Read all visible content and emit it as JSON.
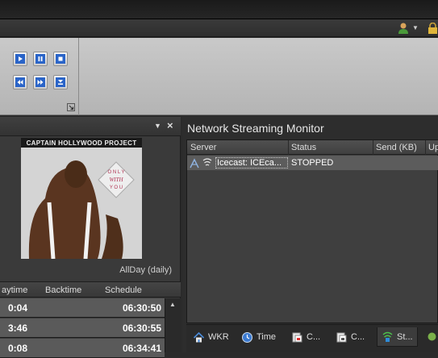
{
  "ribbon": {
    "buttons": [
      "play-icon",
      "pause-icon",
      "stop-icon",
      "rewind-icon",
      "fast-forward-icon",
      "skip-down-icon"
    ],
    "launcher_icon": "dialog-launcher-icon"
  },
  "header": {
    "user_icon": "user-icon",
    "lock_icon": "lock-icon"
  },
  "now_playing": {
    "cover_title": "CAPTAIN HOLLYWOOD PROJECT",
    "cover_badge": [
      "O N L Y",
      "WITH",
      "Y O U"
    ],
    "rotation": "AllDay (daily)",
    "columns": [
      "aytime",
      "Backtime",
      "Schedule"
    ],
    "rows": [
      {
        "playtime": "0:04",
        "schedule": "06:30:50"
      },
      {
        "playtime": "3:46",
        "schedule": "06:30:55"
      },
      {
        "playtime": "0:08",
        "schedule": "06:34:41"
      }
    ]
  },
  "monitor": {
    "title": "Network Streaming Monitor",
    "columns": [
      "Server",
      "Status",
      "Send (KB)",
      "Up"
    ],
    "rows": [
      {
        "server": "Icecast: ICEca...",
        "status": "STOPPED"
      }
    ],
    "tabs": [
      {
        "label": "WKR",
        "icon": "home-icon"
      },
      {
        "label": "Time",
        "icon": "clock-icon"
      },
      {
        "label": "C...",
        "icon": "cart-icon"
      },
      {
        "label": "C...",
        "icon": "cart-icon"
      },
      {
        "label": "St...",
        "icon": "stream-icon"
      }
    ]
  }
}
